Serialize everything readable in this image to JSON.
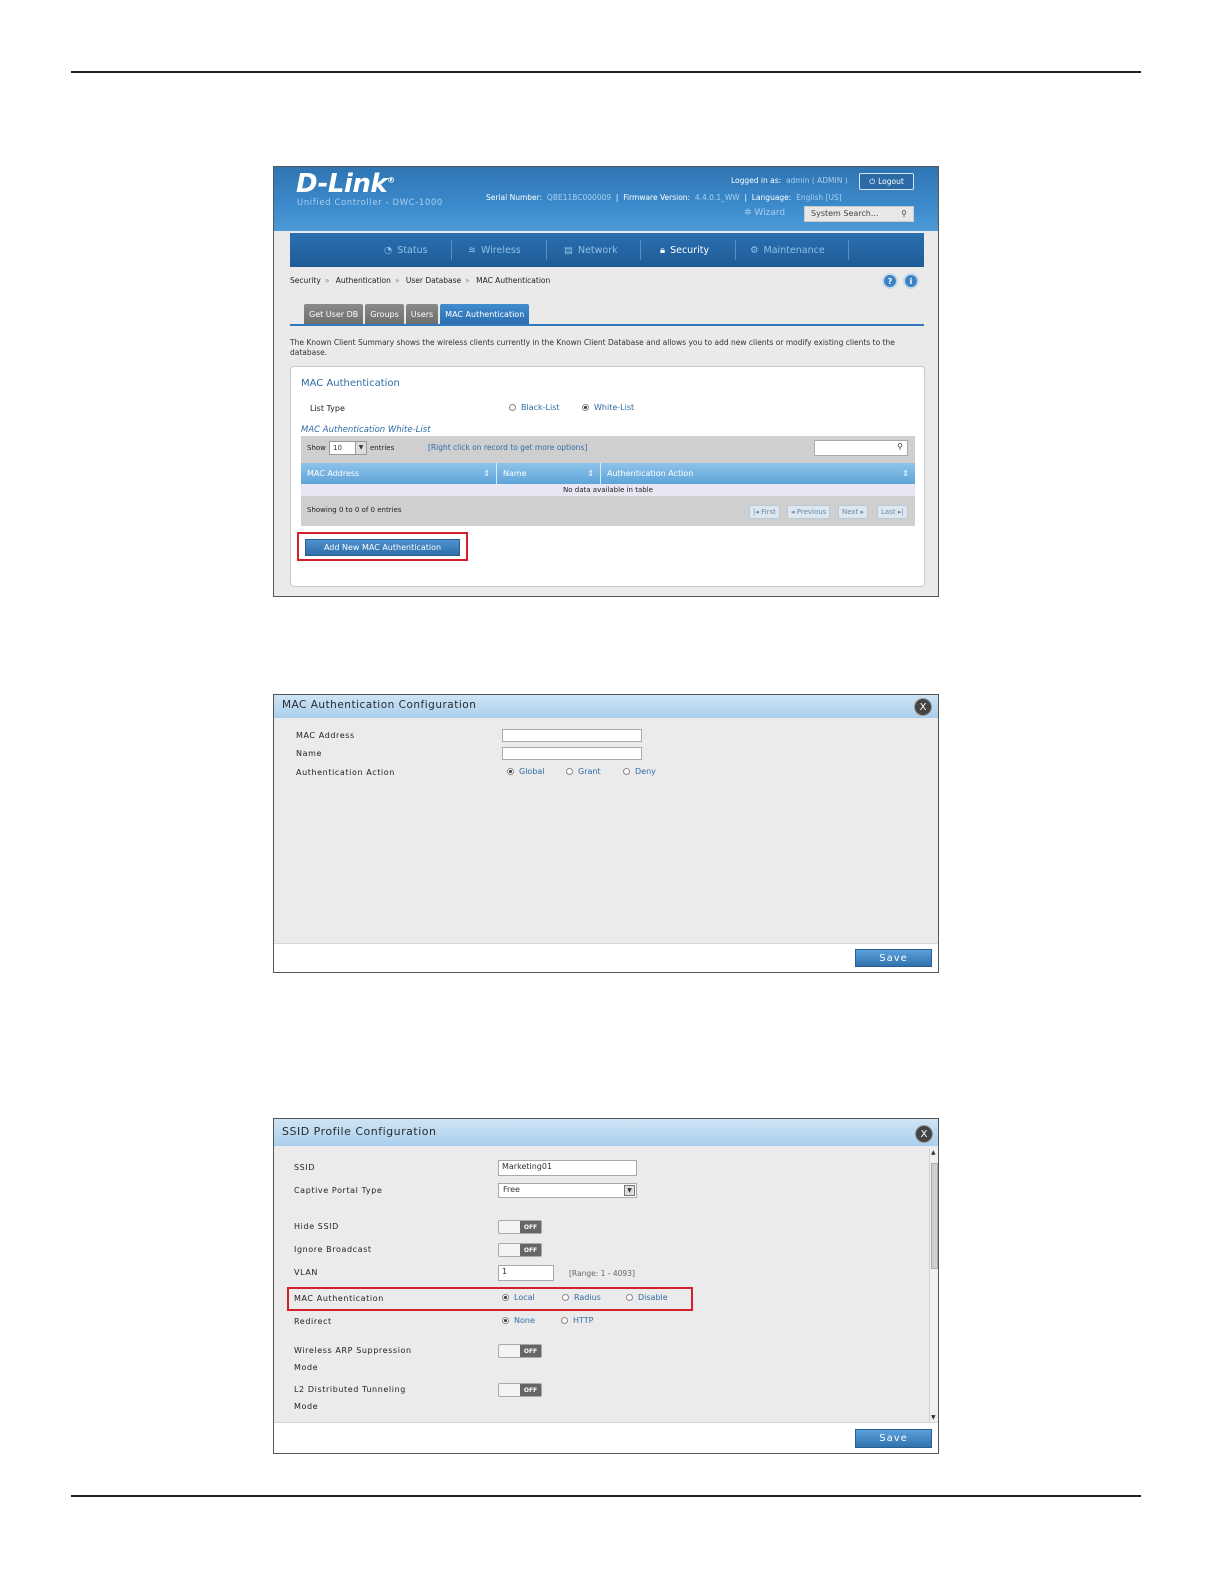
{
  "shot1": {
    "logo": "D-Link",
    "logo_reg": "®",
    "product": "Unified Controller - DWC-1000",
    "logged_in_label": "Logged in as:",
    "logged_in_value": "admin ( ADMIN )",
    "logout": "Logout",
    "serial_label": "Serial Number:",
    "serial_value": "QBE11BC000009",
    "firmware_label": "Firmware Version:",
    "firmware_value": "4.4.0.1_WW",
    "language_label": "Language:",
    "language_value": "English [US]",
    "wizard": "Wizard",
    "search_placeholder": "System Search...",
    "nav": [
      "Status",
      "Wireless",
      "Network",
      "Security",
      "Maintenance"
    ],
    "breadcrumb": [
      "Security",
      "Authentication",
      "User Database",
      "MAC Authentication"
    ],
    "breadcrumb_sep": "»",
    "tabs": [
      "Get User DB",
      "Groups",
      "Users",
      "MAC Authentication"
    ],
    "description": "The Known Client Summary shows the wireless clients currently in the Known Client Database and allows you to add new clients or modify existing clients to the database.",
    "panel_title": "MAC Authentication",
    "list_type_label": "List Type",
    "list_type_options": [
      "Black-List",
      "White-List"
    ],
    "subheading": "MAC Authentication White-List",
    "show_label": "Show",
    "show_value": "10",
    "entries_label": "entries",
    "right_click_hint": "[Right click on record to get more options]",
    "columns": [
      "MAC Address",
      "Name",
      "Authentication Action"
    ],
    "no_data": "No data available in table",
    "showing": "Showing 0 to 0 of 0 entries",
    "pager": [
      "First",
      "Previous",
      "Next",
      "Last"
    ],
    "add_button": "Add New MAC Authentication"
  },
  "shot2": {
    "title": "MAC Authentication Configuration",
    "close": "X",
    "mac_label": "MAC Address",
    "mac_value": "",
    "name_label": "Name",
    "name_value": "",
    "action_label": "Authentication Action",
    "action_options": [
      "Global",
      "Grant",
      "Deny"
    ],
    "action_selected": "Global",
    "save": "Save"
  },
  "shot3": {
    "title": "SSID Profile Configuration",
    "close": "X",
    "ssid_label": "SSID",
    "ssid_value": "Marketing01",
    "portal_label": "Captive Portal Type",
    "portal_value": "Free",
    "hide_ssid_label": "Hide SSID",
    "ignore_broadcast_label": "Ignore Broadcast",
    "vlan_label": "VLAN",
    "vlan_value": "1",
    "vlan_range": "[Range: 1 - 4093]",
    "mac_auth_label": "MAC Authentication",
    "mac_auth_options": [
      "Local",
      "Radius",
      "Disable"
    ],
    "mac_auth_selected": "Local",
    "redirect_label": "Redirect",
    "redirect_options": [
      "None",
      "HTTP"
    ],
    "redirect_selected": "None",
    "arp_label_1": "Wireless ARP Suppression",
    "arp_label_2": "Mode",
    "l2_label_1": "L2 Distributed Tunneling",
    "l2_label_2": "Mode",
    "toggle_off": "OFF",
    "save": "Save"
  }
}
